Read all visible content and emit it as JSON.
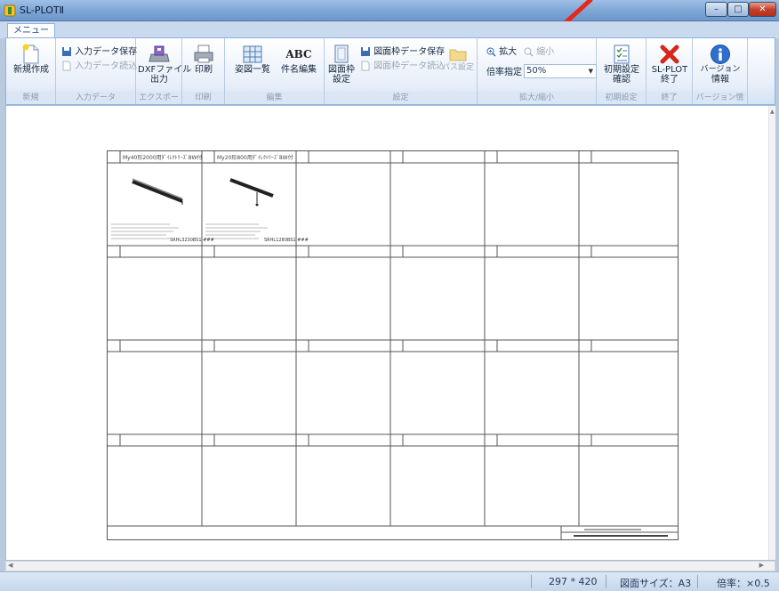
{
  "window": {
    "title": "SL-PLOTⅡ",
    "min_label": "–",
    "max_label": "□",
    "close_label": "✕"
  },
  "ribbon": {
    "tab": "メニュー",
    "groups": {
      "new": {
        "label": "新規",
        "btn_new": "新規作成"
      },
      "input": {
        "label": "入力データ",
        "save": "入力データ保存",
        "load": "入力データ読込"
      },
      "export": {
        "label": "エクスポート",
        "dxf_line1": "DXFファイル",
        "dxf_line2": "出力"
      },
      "print": {
        "label": "印刷",
        "print": "印刷"
      },
      "edit": {
        "label": "編集",
        "list": "姿図一覧",
        "abc": "ABC",
        "name_edit": "件名編集"
      },
      "settings": {
        "label": "設定",
        "frame_line1": "図面枠",
        "frame_line2": "設定",
        "frame_save": "図面枠データ保存",
        "frame_load": "図面枠データ読込",
        "path": "パス設定"
      },
      "zoom": {
        "label": "拡大/縮小",
        "zoom_in": "拡大",
        "zoom_out": "縮小",
        "scale_label": "倍率指定",
        "scale_value": "50%"
      },
      "init": {
        "label": "初期設定",
        "line1": "初期設定",
        "line2": "確認"
      },
      "exit": {
        "label": "終了",
        "line1": "SL-PLOT",
        "line2": "終了"
      },
      "version": {
        "label": "バージョン情報",
        "line1": "バージョン",
        "line2": "情報"
      }
    }
  },
  "sheet": {
    "cells": [
      {
        "title": "My40形2000用ﾀﾞｲﾚｸﾄﾘｰｽﾞ8W付",
        "code": "SRHL3230BS1 ###"
      },
      {
        "title": "My20形800用ﾀﾞｲﾚｸﾄﾘｰｽﾞ8W付",
        "code": "SRHL1280BS1 ###"
      }
    ]
  },
  "status": {
    "paper_dims": "297 * 420",
    "paper_size": "図面サイズ：A3",
    "scale": "倍率：×0.5"
  },
  "colors": {
    "annotation_arrow": "#e8261a",
    "ribbon_border": "#8db2e3"
  }
}
